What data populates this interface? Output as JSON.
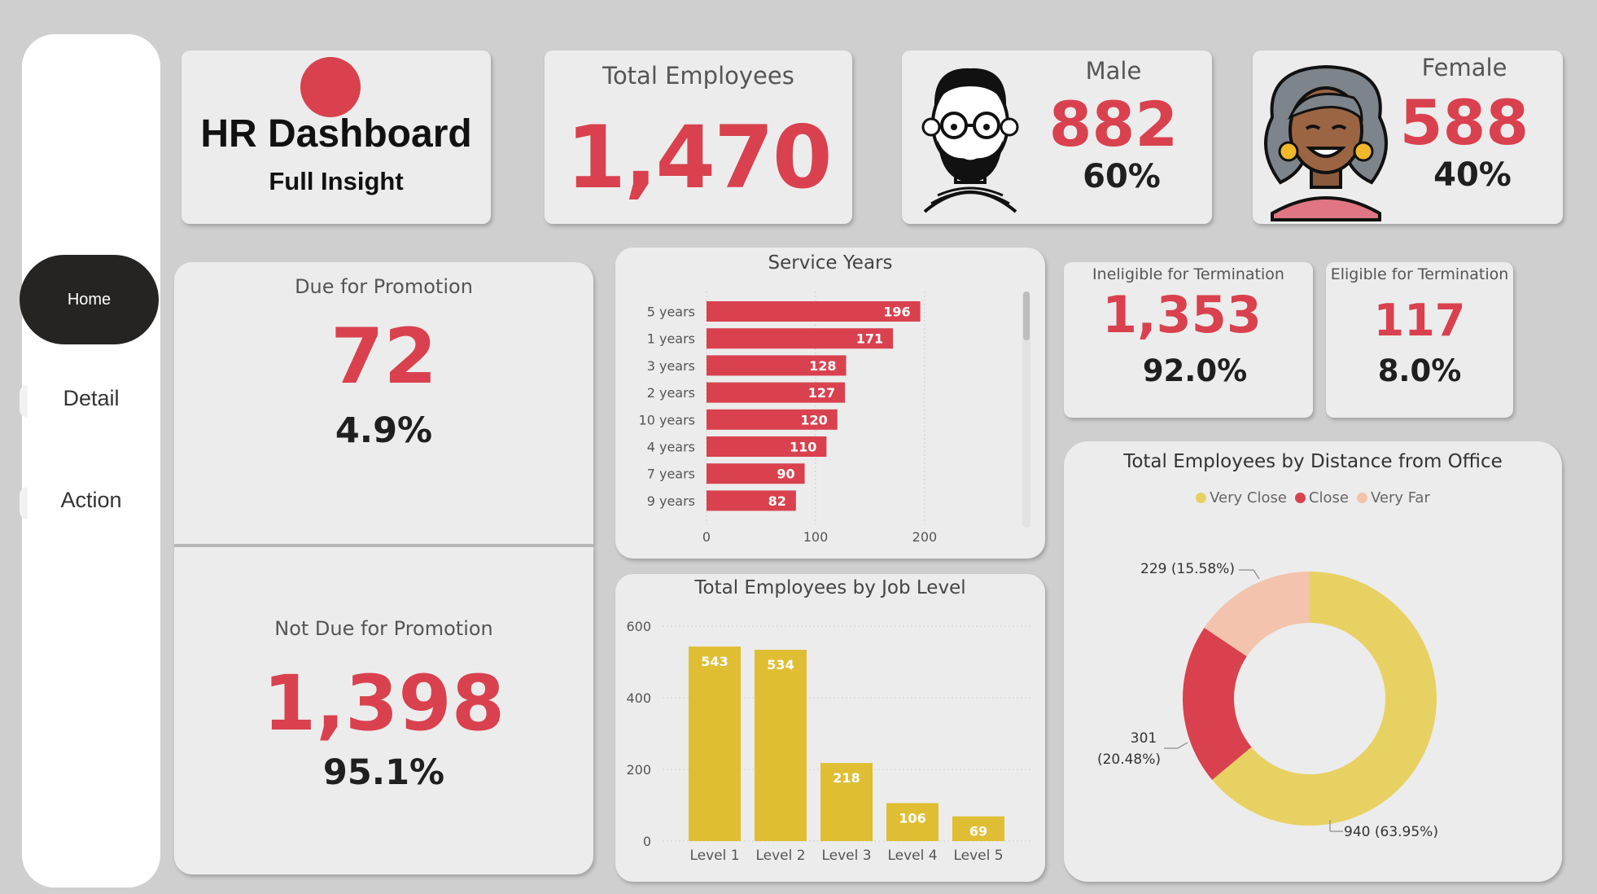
{
  "nav": {
    "home": "Home",
    "detail": "Detail",
    "action": "Action"
  },
  "header": {
    "title": "HR Dashboard",
    "subtitle": "Full Insight"
  },
  "kpis": {
    "total_label": "Total Employees",
    "total_value": "1,470",
    "male_label": "Male",
    "male_value": "882",
    "male_pct": "60%",
    "female_label": "Female",
    "female_value": "588",
    "female_pct": "40%"
  },
  "promotion": {
    "due_label": "Due for Promotion",
    "due_value": "72",
    "due_pct": "4.9%",
    "not_due_label": "Not Due for Promotion",
    "not_due_value": "1,398",
    "not_due_pct": "95.1%"
  },
  "termination": {
    "ineligible_label": "Ineligible for Termination",
    "ineligible_value": "1,353",
    "ineligible_pct": "92.0%",
    "eligible_label": "Eligible for Termination",
    "eligible_value": "117",
    "eligible_pct": "8.0%"
  },
  "colors": {
    "accent_red": "#d9414e",
    "bar_yellow": "#dfbe33",
    "very_close": "#e8d163",
    "close": "#d9414e",
    "very_far": "#f3c3ad"
  },
  "chart_data": [
    {
      "type": "bar",
      "orientation": "horizontal",
      "title": "Service Years",
      "categories": [
        "5 years",
        "1 years",
        "3 years",
        "2 years",
        "10 years",
        "4 years",
        "7 years",
        "9 years"
      ],
      "values": [
        196,
        171,
        128,
        127,
        120,
        110,
        90,
        82
      ],
      "xticks": [
        "0",
        "100",
        "200"
      ],
      "xlim": [
        0,
        220
      ],
      "grid": true
    },
    {
      "type": "bar",
      "title": "Total Employees by Job Level",
      "categories": [
        "Level 1",
        "Level 2",
        "Level 3",
        "Level 4",
        "Level 5"
      ],
      "values": [
        543,
        534,
        218,
        106,
        69
      ],
      "yticks": [
        "0",
        "200",
        "400",
        "600"
      ],
      "ylim": [
        0,
        600
      ],
      "grid": true
    },
    {
      "type": "pie",
      "donut": true,
      "title": "Total Employees by Distance from Office",
      "legend": [
        "Very Close",
        "Close",
        "Very Far"
      ],
      "legend_position": "top",
      "values": [
        940,
        301,
        229
      ],
      "slice_labels": [
        "940 (63.95%)",
        "301",
        "(20.48%)",
        "229 (15.58%)"
      ]
    }
  ]
}
